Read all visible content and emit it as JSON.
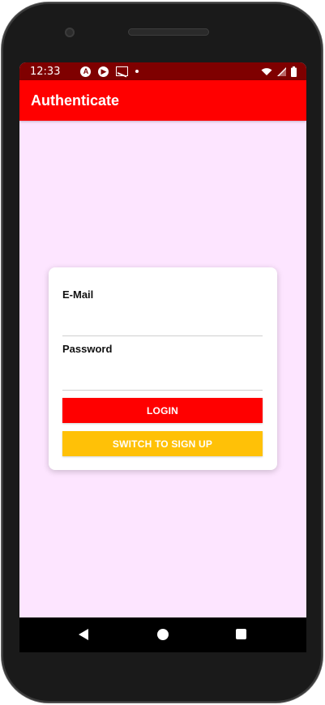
{
  "status_bar": {
    "time": "12:33",
    "left_icons": [
      "android-studio-icon",
      "play-icon",
      "gmail-icon",
      "notification-dot-icon"
    ],
    "right_icons": [
      "wifi-icon",
      "signal-icon",
      "battery-icon"
    ]
  },
  "app_bar": {
    "title": "Authenticate"
  },
  "login_card": {
    "email_label": "E-Mail",
    "email_value": "",
    "password_label": "Password",
    "password_value": "",
    "login_button": "LOGIN",
    "switch_button": "SWITCH TO SIGN UP"
  },
  "navigation": {
    "items": [
      "back-icon",
      "home-icon",
      "recents-icon"
    ]
  },
  "colors": {
    "status_bar": "#7f0000",
    "app_bar": "#ff0000",
    "screen_background": "#fde5ff",
    "login_button": "#ff0000",
    "switch_button": "#ffc107"
  }
}
